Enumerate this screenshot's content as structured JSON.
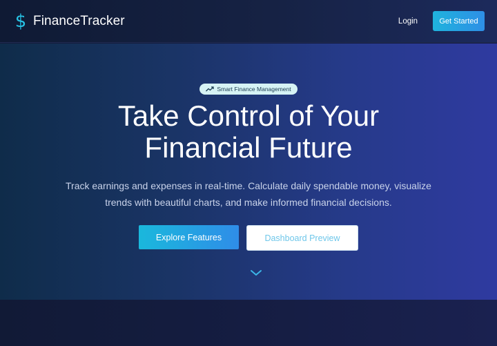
{
  "navbar": {
    "brand_icon": "dollar-sign-icon",
    "brand_icon_glyph": "$",
    "brand_name": "FinanceTracker",
    "login_label": "Login",
    "get_started_label": "Get Started"
  },
  "hero": {
    "badge_icon": "trending-up-icon",
    "badge_label": "Smart Finance Management",
    "headline_line1": "Take Control of Your",
    "headline_line2": "Financial Future",
    "subtitle_line1": "Track earnings and expenses in real-time. Calculate daily spendable money, visualize",
    "subtitle_line2": "trends with beautiful charts, and make informed financial decisions.",
    "primary_button_label": "Explore Features",
    "secondary_button_label": "Dashboard Preview",
    "scroll_icon": "chevron-down-icon"
  },
  "colors": {
    "accent": "#27c3e6",
    "primary_gradient_start": "#1ab8dc",
    "primary_gradient_end": "#2f8de8",
    "hero_gradient_left": "#0f2c4a",
    "hero_gradient_right": "#2f3aa0"
  }
}
